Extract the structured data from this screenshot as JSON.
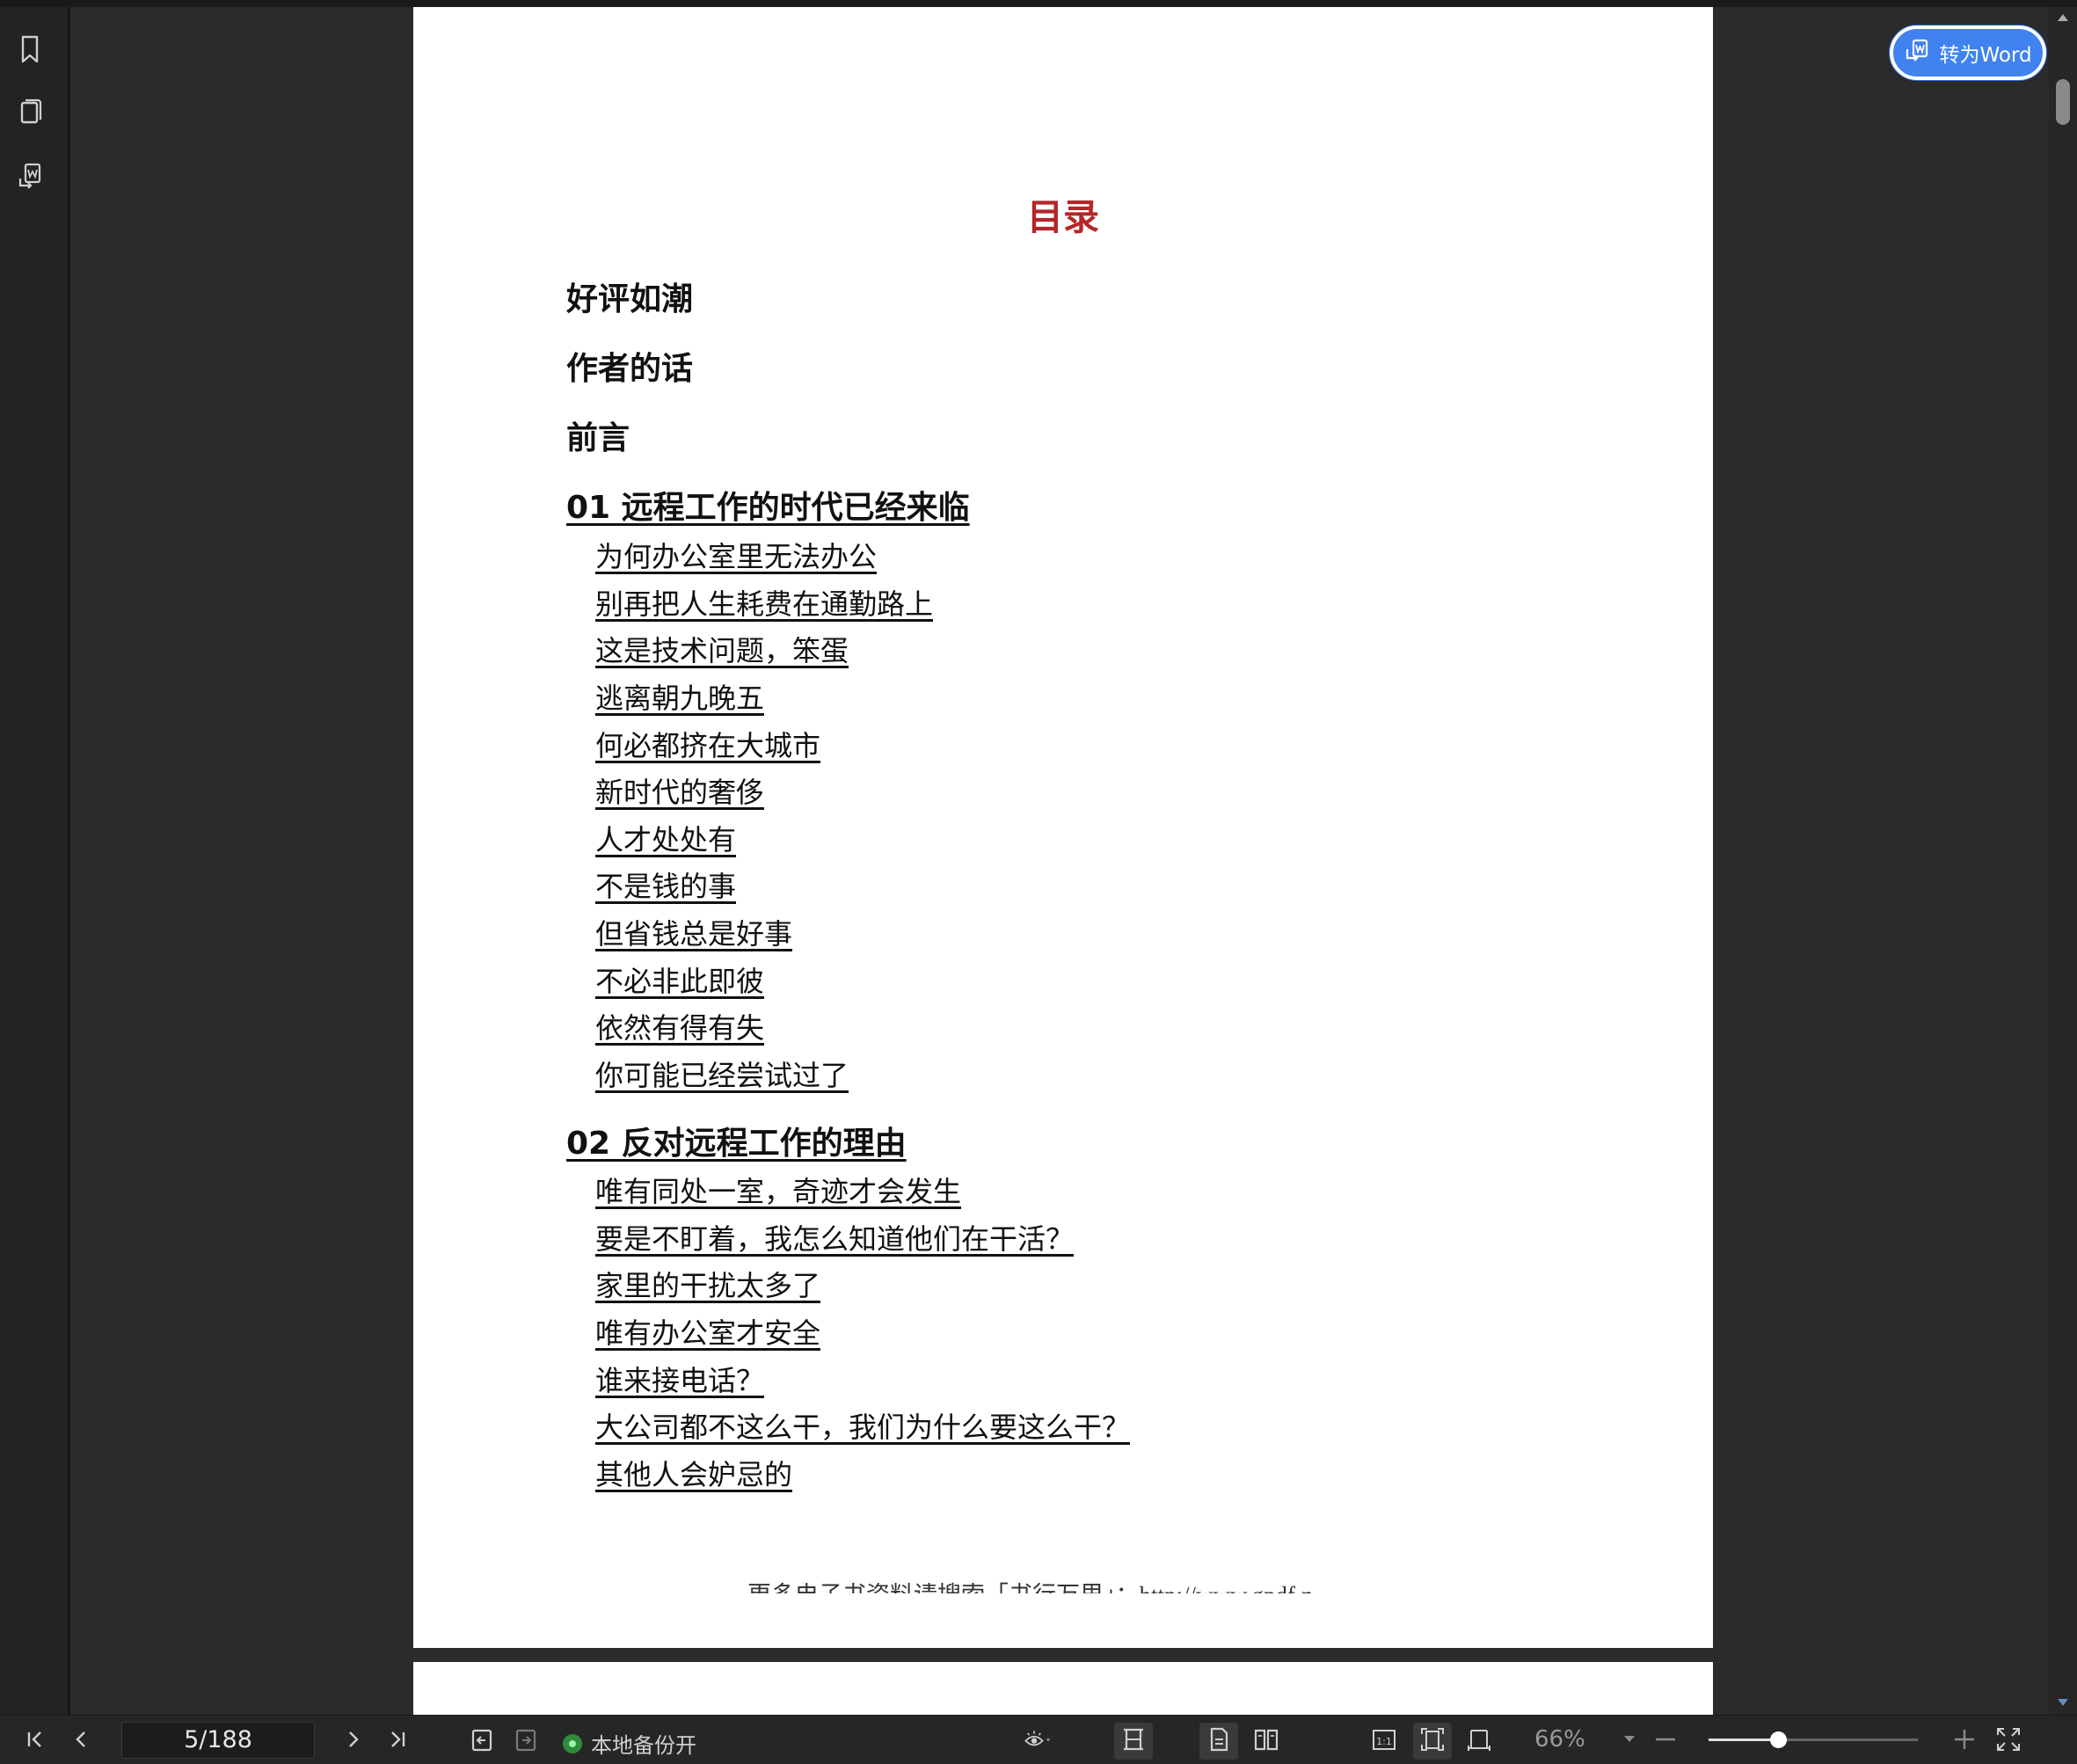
{
  "left_toolbar": {
    "icons": [
      "bookmark-icon",
      "thumbnail-icon",
      "convert-document-icon"
    ]
  },
  "document": {
    "toc_title": "目录",
    "front_matter": [
      "好评如潮",
      "作者的话",
      "前言"
    ],
    "chapters": [
      {
        "title": "01 远程工作的时代已经来临",
        "items": [
          "为何办公室里无法办公",
          "别再把人生耗费在通勤路上",
          "这是技术问题，笨蛋",
          "逃离朝九晚五",
          "何必都挤在大城市",
          "新时代的奢侈",
          "人才处处有",
          "不是钱的事",
          "但省钱总是好事",
          "不必非此即彼",
          "依然有得有失",
          "你可能已经尝试过了"
        ]
      },
      {
        "title": "02 反对远程工作的理由",
        "items": [
          "唯有同处一室，奇迹才会发生",
          "要是不盯着，我怎么知道他们在干活？",
          "家里的干扰太多了",
          "唯有办公室才安全",
          "谁来接电话？",
          "大公司都不这么干，我们为什么要这么干？",
          "其他人会妒忌的"
        ]
      }
    ],
    "footer": "更多电子书资料请搜索「书行万里」：http://www.gpdf.n"
  },
  "convert_button": {
    "label": "转为Word",
    "color": "#3f82f0"
  },
  "status_bar": {
    "page_indicator": "5/188",
    "backup_status": "本地备份开",
    "backup_color": "#2e8b3a",
    "zoom": "66%",
    "zoom_slider_fraction": 0.33
  },
  "colors": {
    "toc_title": "#b3262a",
    "background": "#2b2b2b"
  }
}
